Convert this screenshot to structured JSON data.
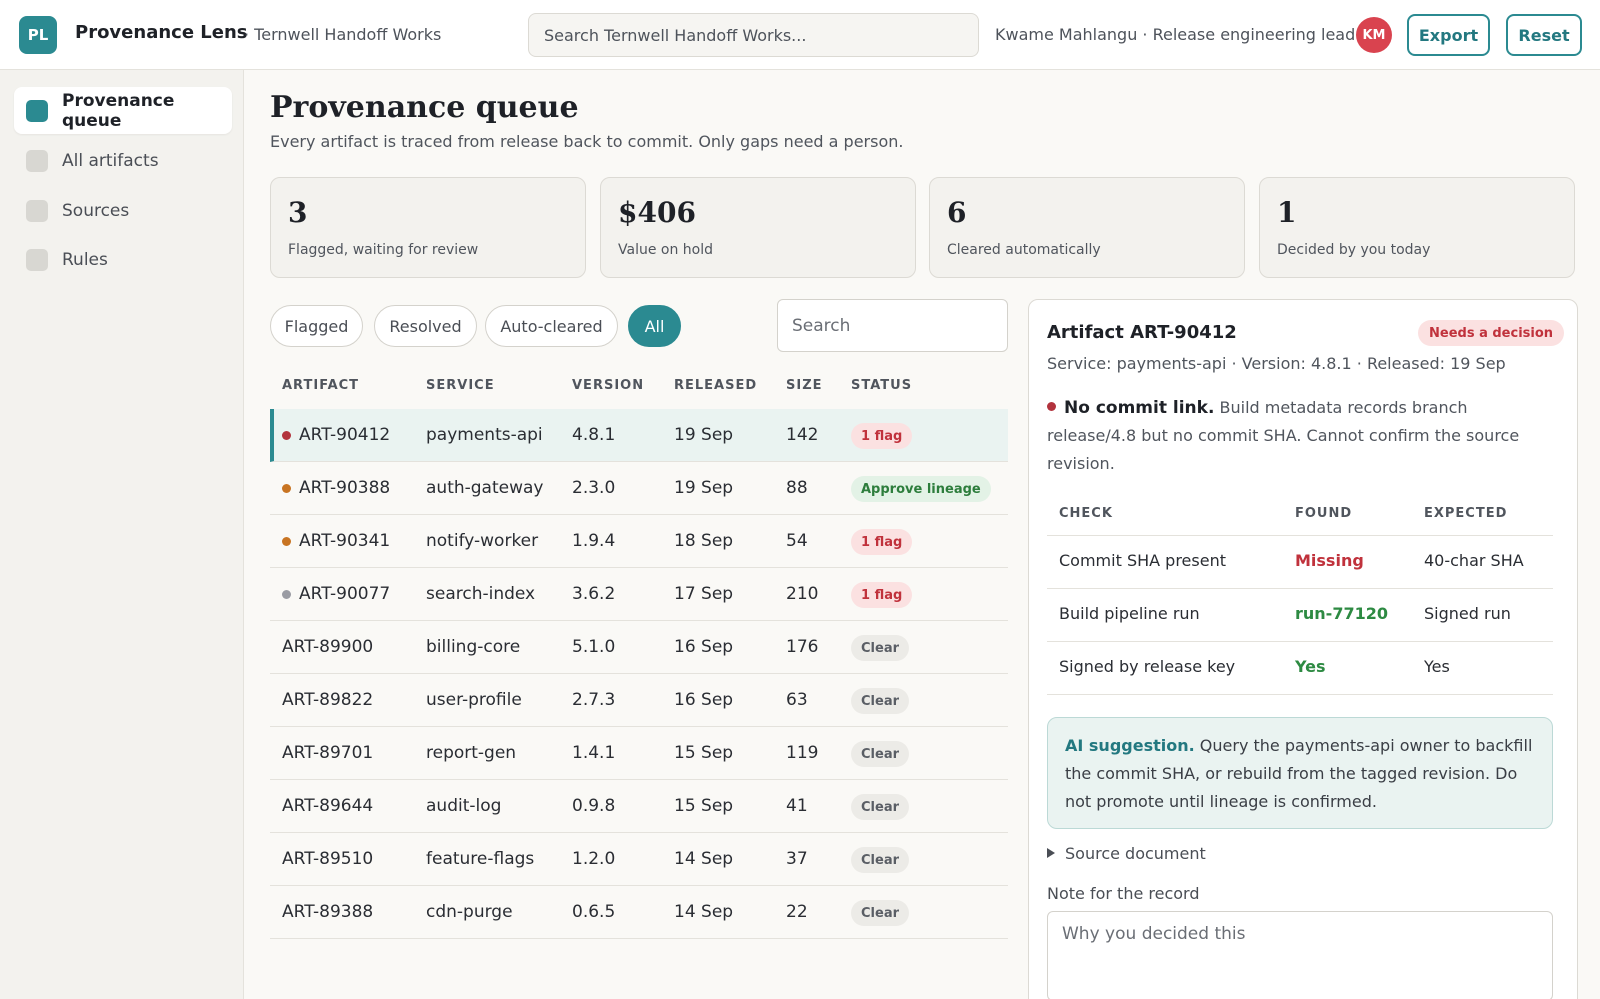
{
  "app": {
    "logo_text": "PL",
    "name": "Provenance Lens",
    "org": "· Ternwell Handoff Works"
  },
  "header": {
    "search_placeholder": "Search Ternwell Handoff Works...",
    "user": "Kwame Mahlangu · Release engineering lead",
    "avatar_initials": "KM",
    "export_label": "Export",
    "reset_label": "Reset"
  },
  "sidebar": {
    "items": [
      {
        "label": "Provenance queue",
        "active": true
      },
      {
        "label": "All artifacts",
        "active": false
      },
      {
        "label": "Sources",
        "active": false
      },
      {
        "label": "Rules",
        "active": false
      }
    ]
  },
  "page": {
    "title": "Provenance queue",
    "subtitle": "Every artifact is traced from release back to commit. Only gaps need a person."
  },
  "stats": [
    {
      "value": "3",
      "label": "Flagged, waiting for review"
    },
    {
      "value": "$406",
      "label": "Value on hold"
    },
    {
      "value": "6",
      "label": "Cleared automatically"
    },
    {
      "value": "1",
      "label": "Decided by you today"
    }
  ],
  "filters": {
    "chips": [
      "Flagged",
      "Resolved",
      "Auto-cleared",
      "All"
    ],
    "active": "All",
    "search_placeholder": "Search"
  },
  "table": {
    "columns": [
      "ARTIFACT",
      "SERVICE",
      "VERSION",
      "RELEASED",
      "SIZE",
      "STATUS"
    ],
    "rows": [
      {
        "artifact": "ART-90412",
        "service": "payments-api",
        "version": "4.8.1",
        "released": "19 Sep",
        "size": "142",
        "status": "1 flag",
        "status_kind": "flag",
        "dot": "#b2333d",
        "selected": true
      },
      {
        "artifact": "ART-90388",
        "service": "auth-gateway",
        "version": "2.3.0",
        "released": "19 Sep",
        "size": "88",
        "status": "Approve lineage",
        "status_kind": "approve",
        "dot": "#c87422",
        "selected": false
      },
      {
        "artifact": "ART-90341",
        "service": "notify-worker",
        "version": "1.9.4",
        "released": "18 Sep",
        "size": "54",
        "status": "1 flag",
        "status_kind": "flag",
        "dot": "#c87422",
        "selected": false
      },
      {
        "artifact": "ART-90077",
        "service": "search-index",
        "version": "3.6.2",
        "released": "17 Sep",
        "size": "210",
        "status": "1 flag",
        "status_kind": "flag",
        "dot": "#9a9ca3",
        "selected": false
      },
      {
        "artifact": "ART-89900",
        "service": "billing-core",
        "version": "5.1.0",
        "released": "16 Sep",
        "size": "176",
        "status": "Clear",
        "status_kind": "clear",
        "dot": "",
        "selected": false
      },
      {
        "artifact": "ART-89822",
        "service": "user-profile",
        "version": "2.7.3",
        "released": "16 Sep",
        "size": "63",
        "status": "Clear",
        "status_kind": "clear",
        "dot": "",
        "selected": false
      },
      {
        "artifact": "ART-89701",
        "service": "report-gen",
        "version": "1.4.1",
        "released": "15 Sep",
        "size": "119",
        "status": "Clear",
        "status_kind": "clear",
        "dot": "",
        "selected": false
      },
      {
        "artifact": "ART-89644",
        "service": "audit-log",
        "version": "0.9.8",
        "released": "15 Sep",
        "size": "41",
        "status": "Clear",
        "status_kind": "clear",
        "dot": "",
        "selected": false
      },
      {
        "artifact": "ART-89510",
        "service": "feature-flags",
        "version": "1.2.0",
        "released": "14 Sep",
        "size": "37",
        "status": "Clear",
        "status_kind": "clear",
        "dot": "",
        "selected": false
      },
      {
        "artifact": "ART-89388",
        "service": "cdn-purge",
        "version": "0.6.5",
        "released": "14 Sep",
        "size": "22",
        "status": "Clear",
        "status_kind": "clear",
        "dot": "",
        "selected": false
      }
    ]
  },
  "detail": {
    "title": "Artifact ART-90412",
    "status": "Needs a decision",
    "meta": "Service: payments-api · Version: 4.8.1 · Released: 19 Sep",
    "issue_title": "No commit link.",
    "issue_text": "Build metadata records branch release/4.8 but no commit SHA. Cannot confirm the source revision.",
    "checks": {
      "columns": [
        "CHECK",
        "FOUND",
        "EXPECTED"
      ],
      "rows": [
        {
          "check": "Commit SHA present",
          "found": "Missing",
          "found_kind": "bad",
          "expected": "40-char SHA"
        },
        {
          "check": "Build pipeline run",
          "found": "run-77120",
          "found_kind": "good",
          "expected": "Signed run"
        },
        {
          "check": "Signed by release key",
          "found": "Yes",
          "found_kind": "good",
          "expected": "Yes"
        }
      ]
    },
    "ai_title": "AI suggestion.",
    "ai_text": "Query the payments-api owner to backfill the commit SHA, or rebuild from the tagged revision. Do not promote until lineage is confirmed.",
    "source_doc": "Source document",
    "note_label": "Note for the record",
    "note_placeholder": "Why you decided this"
  },
  "colors": {
    "accent": "#2b8a91",
    "danger": "#c0323c",
    "success": "#2d8a42",
    "warning": "#c87422"
  }
}
